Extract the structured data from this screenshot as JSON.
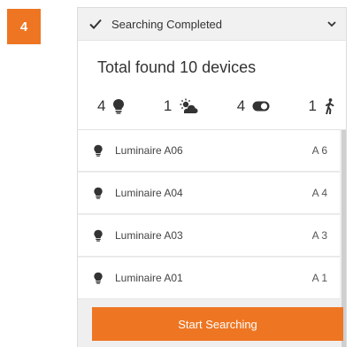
{
  "step": {
    "number": "4"
  },
  "status": {
    "text": "Searching Completed",
    "check_icon": "check-icon",
    "toggle_icon": "chevron-down-icon"
  },
  "summary": {
    "title": "Total found 10 devices"
  },
  "counts": [
    {
      "value": "4",
      "icon": "bulb-icon"
    },
    {
      "value": "1",
      "icon": "sun-cloud-icon"
    },
    {
      "value": "4",
      "icon": "toggle-icon"
    },
    {
      "value": "1",
      "icon": "walking-person-icon"
    }
  ],
  "devices": [
    {
      "name": "Luminaire A06",
      "code": "A 6",
      "icon": "bulb-icon"
    },
    {
      "name": "Luminaire A04",
      "code": "A 4",
      "icon": "bulb-icon"
    },
    {
      "name": "Luminaire A03",
      "code": "A 3",
      "icon": "bulb-icon"
    },
    {
      "name": "Luminaire A01",
      "code": "A 1",
      "icon": "bulb-icon"
    }
  ],
  "action": {
    "label": "Start Searching"
  },
  "colors": {
    "accent": "#ee7623",
    "text": "#333333",
    "header_bg": "#f1f1f1",
    "list_bg": "#efefef"
  }
}
